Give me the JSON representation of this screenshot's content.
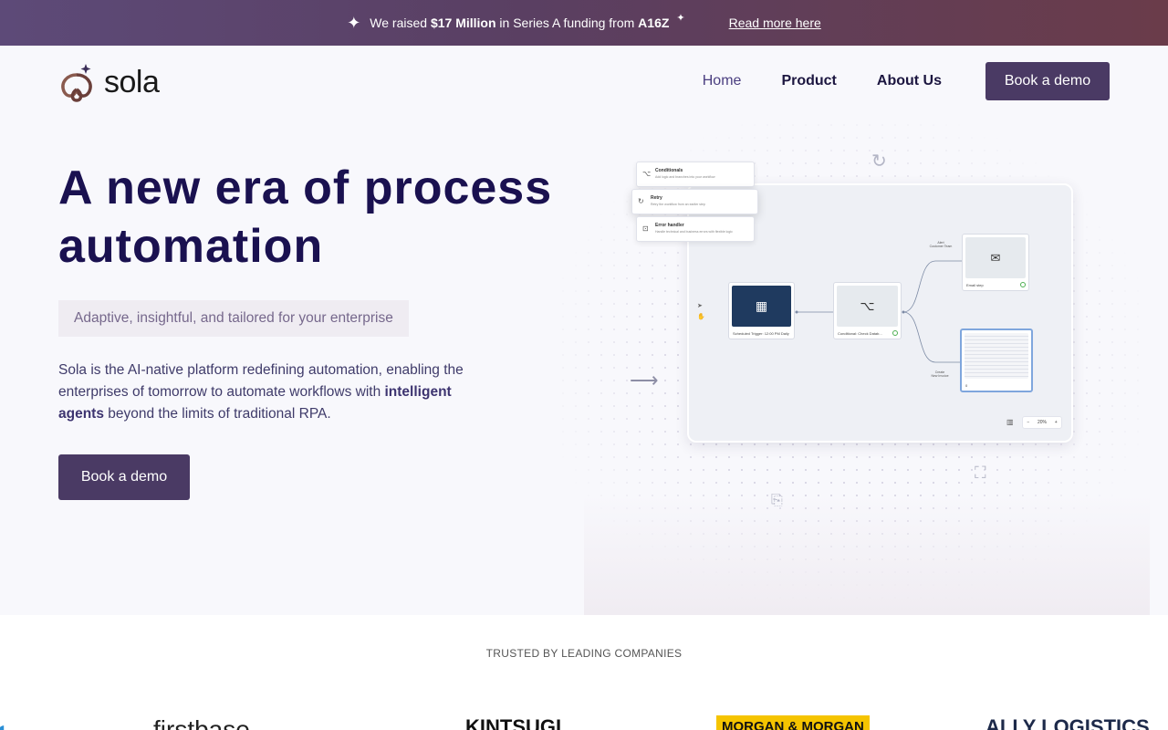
{
  "announcement": {
    "prefix": "We raised ",
    "amount": "$17 Million",
    "middle": " in Series A funding from ",
    "investor": "A16Z",
    "link": "Read more here"
  },
  "brand": {
    "name": "sola"
  },
  "nav": {
    "items": [
      {
        "label": "Home",
        "active": true
      },
      {
        "label": "Product",
        "active": false
      },
      {
        "label": "About Us",
        "active": false
      }
    ],
    "cta": "Book a demo"
  },
  "hero": {
    "title_line1": "A new era of process",
    "title_line2": "automation",
    "tagline": "Adaptive, insightful, and tailored for your enterprise",
    "desc_part1": "Sola is the AI-native platform redefining automation, enabling the enterprises of tomorrow to automate workflows with ",
    "desc_bold": "intelligent agents",
    "desc_part2": " beyond the limits of traditional RPA.",
    "cta": "Book a demo"
  },
  "illustration": {
    "menu": [
      {
        "title": "Conditionals",
        "sub": "Add logic and branches into your workflow",
        "icon": "branch-icon"
      },
      {
        "title": "Retry",
        "sub": "Retry the workflow from an earlier step",
        "icon": "retry-icon"
      },
      {
        "title": "Error handler",
        "sub": "Handle technical and business errors with flexible logic",
        "icon": "error-icon"
      }
    ],
    "nodes": {
      "trigger": "Scheduled Trigger: 12:00 PM Daily",
      "conditional": "Conditional: Check Datab...",
      "email": "Email step",
      "invoice": "0"
    },
    "edge_labels": {
      "top": "Alert\nCustomer Team",
      "bottom": "Create\nNew Invoice"
    },
    "zoom": "20%",
    "colors": {
      "trigger_bg": "#1f3a5f",
      "selected_border": "#7fa6dd"
    }
  },
  "trusted": {
    "title": "TRUSTED BY LEADING COMPANIES",
    "companies": [
      "firstbase",
      "KINTSUGI",
      "MORGAN & MORGAN",
      "ALLY LOGISTICS"
    ]
  },
  "colors": {
    "primary_button": "#4a3a64",
    "heading": "#1a1150",
    "banner_start": "#5d4a78",
    "banner_end": "#6a3c4a"
  }
}
